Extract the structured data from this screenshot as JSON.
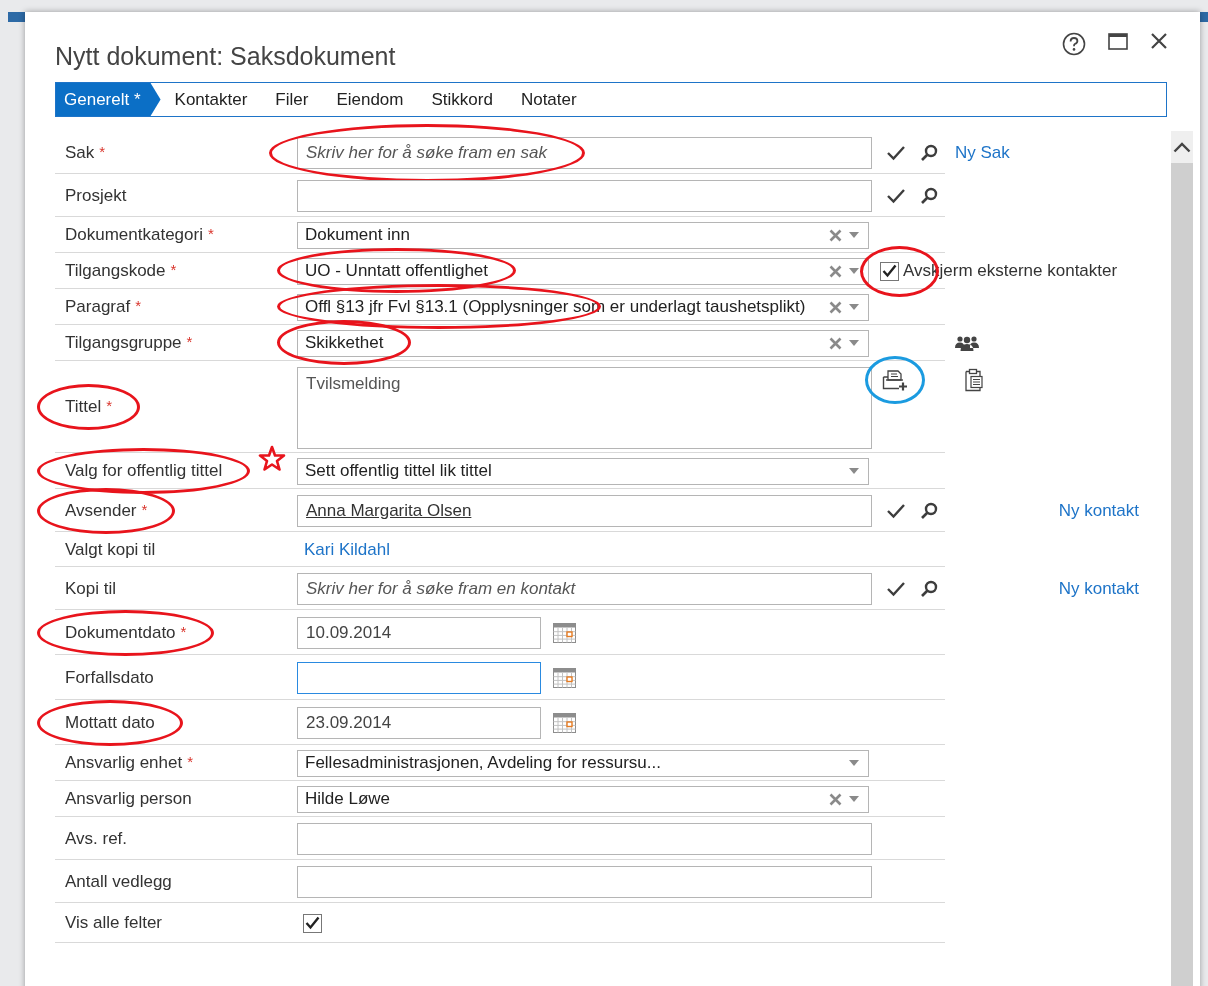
{
  "window": {
    "title": "Nytt dokument: Saksdokument"
  },
  "tabs": [
    {
      "label": "Generelt *",
      "selected": true
    },
    {
      "label": "Kontakter",
      "selected": false
    },
    {
      "label": "Filer",
      "selected": false
    },
    {
      "label": "Eiendom",
      "selected": false
    },
    {
      "label": "Stikkord",
      "selected": false
    },
    {
      "label": "Notater",
      "selected": false
    }
  ],
  "rows": [
    {
      "kind": "lookup",
      "label": "Sak",
      "required_mark": "*",
      "placeholder": "Skriv her for å søke fram en sak",
      "side_link": "Ny Sak",
      "value_marks": [
        {
          "kind": "ellipse",
          "color": "#e8141c"
        }
      ]
    },
    {
      "kind": "lookup",
      "label": "Prosjekt"
    },
    {
      "kind": "combo",
      "label": "Dokumentkategori",
      "required_mark": "*",
      "value": "Dokument inn",
      "clearable": true
    },
    {
      "kind": "combo",
      "label": "Tilgangskode",
      "required_mark": "*",
      "value": "UO - Unntatt offentlighet",
      "clearable": true,
      "option": {
        "label": "Avskjerm eksterne kontakter",
        "checked": true
      },
      "value_marks": [
        {
          "kind": "ellipse",
          "color": "#e8141c"
        }
      ],
      "option_marks": [
        {
          "kind": "ellipse",
          "color": "#e8141c"
        }
      ]
    },
    {
      "kind": "combo",
      "label": "Paragraf",
      "required_mark": "*",
      "value": "Offl §13 jfr Fvl §13.1 (Opplysninger som er underlagt taushetsplikt)",
      "clearable": true,
      "value_marks": [
        {
          "kind": "partial",
          "color": "#e8141c"
        }
      ]
    },
    {
      "kind": "combo",
      "label": "Tilgangsgruppe",
      "required_mark": "*",
      "value": "Skikkethet",
      "clearable": true,
      "side_button": true,
      "value_marks": [
        {
          "kind": "ellipse",
          "color": "#e8141c"
        }
      ]
    },
    {
      "kind": "textarea",
      "label": "Tittel",
      "required_mark": "*",
      "value": "Tvilsmelding",
      "template_button": true,
      "side_button": true,
      "label_marks": [
        {
          "kind": "ellipse",
          "color": "#e8141c"
        }
      ],
      "action_marks": [
        {
          "kind": "ellipse",
          "color": "#1b9be0"
        }
      ]
    },
    {
      "kind": "combo",
      "label": "Valg for offentlig tittel",
      "value": "Sett offentlig tittel lik tittel",
      "clearable": false,
      "label_marks": [
        {
          "kind": "ellipse",
          "color": "#e8141c"
        },
        {
          "kind": "star",
          "color": "#e8141c"
        }
      ]
    },
    {
      "kind": "lookup",
      "label": "Avsender",
      "required_mark": "*",
      "value": "Anna Margarita Olsen",
      "side_link": "Ny kontakt",
      "label_marks": [
        {
          "kind": "ellipse",
          "color": "#e8141c"
        }
      ]
    },
    {
      "kind": "link",
      "label": "Valgt kopi til",
      "value": "Kari Kildahl"
    },
    {
      "kind": "lookup",
      "label": "Kopi til",
      "placeholder": "Skriv her for å søke fram en kontakt",
      "side_link": "Ny kontakt"
    },
    {
      "kind": "date",
      "label": "Dokumentdato",
      "required_mark": "*",
      "value": "10.09.2014",
      "focused": false,
      "label_marks": [
        {
          "kind": "ellipse",
          "color": "#e8141c"
        }
      ]
    },
    {
      "kind": "date",
      "label": "Forfallsdato",
      "focused": true
    },
    {
      "kind": "date",
      "label": "Mottatt dato",
      "value": "23.09.2014",
      "focused": false,
      "label_marks": [
        {
          "kind": "ellipse",
          "color": "#e8141c"
        }
      ]
    },
    {
      "kind": "combo",
      "label": "Ansvarlig enhet",
      "required_mark": "*",
      "value": "Fellesadministrasjonen, Avdeling for ressursu...",
      "clearable": false
    },
    {
      "kind": "combo",
      "label": "Ansvarlig person",
      "value": "Hilde Løwe",
      "clearable": true
    },
    {
      "kind": "text",
      "label": "Avs. ref."
    },
    {
      "kind": "text",
      "label": "Antall vedlegg"
    },
    {
      "kind": "checkbox",
      "label": "Vis alle felter",
      "checked": true
    }
  ]
}
